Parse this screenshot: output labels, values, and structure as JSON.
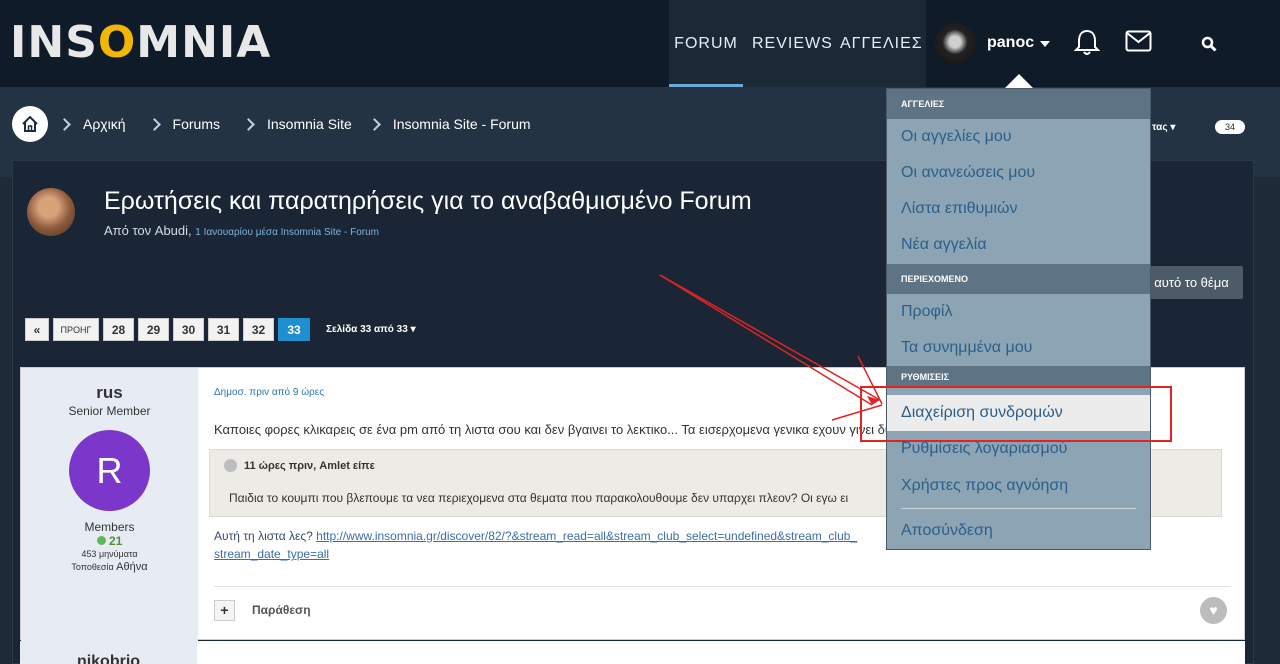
{
  "header": {
    "logo": {
      "text_before": "INS",
      "moon": "O",
      "text_after": "MNIA"
    },
    "nav": [
      "FORUM",
      "REVIEWS",
      "ΑΓΓΕΛΙΕΣ"
    ],
    "user": "panoc",
    "icons": [
      "bell-icon",
      "mail-icon",
      "search-icon"
    ]
  },
  "breadcrumb": [
    "Αρχική",
    "Forums",
    "Insomnia Site",
    "Insomnia Site - Forum"
  ],
  "topic": {
    "title": "Ερωτήσεις και παρατηρήσεις για το αναβαθμισμένο Forum",
    "by": "Από τον Abudi,",
    "meta": "1 Ιανουαρίου μέσα Insomnia Site - Forum",
    "follow_label": "αυτό το θέμα",
    "follow_count": "34",
    "tas": "τας"
  },
  "pagination": {
    "prev_symbol": "«",
    "prev_label": "ΠΡΟΗΓ",
    "pages": [
      "28",
      "29",
      "30",
      "31",
      "32",
      "33"
    ],
    "current": "33",
    "info": "Σελίδα 33 από 33"
  },
  "post": {
    "author": "rus",
    "rank": "Senior Member",
    "avatar_letter": "R",
    "group": "Members",
    "rep": "21",
    "posts": "453 μηνύματα",
    "location_label": "Τοποθεσία",
    "location": "Αθήνα",
    "date": "Δημοσ. πριν από 9 ώρες",
    "text": "Καποιες φορες κλικαρεις σε ένα pm από τη λιστα σου και δεν βγαινει το λεκτικο... Τα εισερχομενα γενικα εχουν γινει δυ",
    "quote_head": "11 ώρες πριν, Amlet είπε",
    "quote_text": "Παιδια το κουμπι που βλεπουμε τα νεα περιεχομενα στα θεματα που παρακολουθουμε δεν υπαρχει πλεον? Οι εγω ει",
    "link_prefix": "Αυτή τη λιστα λες?",
    "link_line1": "http://www.insomnia.gr/discover/82/?&stream_read=all&stream_club_select=undefined&stream_club_",
    "link_line2": "stream_date_type=all",
    "quote_button": "Παράθεση"
  },
  "post2": {
    "author": "nikobrio"
  },
  "dropdown": {
    "sections": [
      {
        "title": "ΑΓΓΕΛΙΕΣ",
        "items": [
          "Οι αγγελίες μου",
          "Οι ανανεώσεις μου",
          "Λίστα επιθυμιών",
          "Νέα αγγελία"
        ]
      },
      {
        "title": "ΠΕΡΙΕΧΟΜΕΝΟ",
        "items": [
          "Προφίλ",
          "Τα συνημμένα μου"
        ]
      },
      {
        "title": "ΡΥΘΜΙΣΕΙΣ",
        "items": [
          "Διαχείριση συνδρομών",
          "Ρυθμίσεις λογαριασμού",
          "Χρήστες προς αγνόηση"
        ]
      }
    ],
    "logout": "Αποσύνδεση",
    "highlighted": "Διαχείριση συνδρομών"
  },
  "colors": {
    "accent": "#1f8fd0",
    "header_bg": "#0f1b29",
    "dropdown_bg": "#8da4b4",
    "annotation": "#e02424"
  }
}
